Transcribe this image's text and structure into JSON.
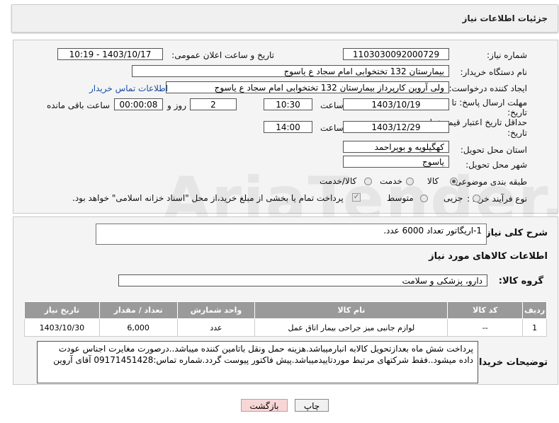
{
  "header": {
    "title": "جزئیات اطلاعات نیاز"
  },
  "watermark": "AriaTender.net",
  "form": {
    "need_number_label": "شماره نیاز:",
    "need_number": "1103030092000729",
    "announce_label": "تاریخ و ساعت اعلان عمومی:",
    "announce_value": "1403/10/17 - 10:19",
    "buyer_org_label": "نام دستگاه خریدار:",
    "buyer_org": "بیمارستان 132 تختخوابی امام سجاد  ع  یاسوج",
    "creator_label": "ایجاد کننده درخواست:",
    "creator": "ولی آروین کارپرداز بیمارستان 132 تختخوابی امام سجاد  ع  یاسوج",
    "contact_link": "اطلاعات تماس خریدار",
    "deadline_label_1": "مهلت ارسال پاسخ: تا",
    "deadline_label_2": "تاریخ:",
    "deadline_date": "1403/10/19",
    "time_label": "ساعت",
    "deadline_time": "10:30",
    "days_value": "2",
    "days_label": "روز و",
    "remaining_value": "00:00:08",
    "remaining_label": "ساعت باقی مانده",
    "validity_label_1": "حداقل تاریخ اعتبار قیمت: تا",
    "validity_label_2": "تاریخ:",
    "validity_date": "1403/12/29",
    "validity_time": "14:00",
    "province_label": "استان محل تحویل:",
    "province": "کهگیلویه و بویراحمد",
    "city_label": "شهر محل تحویل:",
    "city": "یاسوج",
    "category_label": "طبقه بندی موضوعی:",
    "category_options": [
      "کالا",
      "خدمت",
      "کالا/خدمت"
    ],
    "process_label": "نوع فرآیند خرید :",
    "process_options": [
      "جزیی",
      "متوسط"
    ],
    "payment_note": "پرداخت تمام یا بخشی از مبلغ خرید،از محل \"اسناد خزانه اسلامی\" خواهد بود."
  },
  "details": {
    "summary_label": "شرح کلی نیاز:",
    "summary": "1-اریگاتور تعداد 6000 عدد.",
    "goods_info_title": "اطلاعات کالاهای مورد نیاز",
    "goods_group_label": "گروه کالا:",
    "goods_group": "دارو، پزشکی و سلامت",
    "table_headers": [
      "ردیف",
      "کد کالا",
      "نام کالا",
      "واحد شمارش",
      "تعداد / مقدار",
      "تاریخ نیاز"
    ],
    "rows": [
      {
        "row": "1",
        "code": "--",
        "name": "لوازم جانبی میز جراحی بیمار اتاق عمل",
        "unit": "عدد",
        "qty": "6,000",
        "date": "1403/10/30"
      }
    ],
    "buyer_notes_label": "توضیحات خریدار:",
    "buyer_notes": "پرداخت شش ماه بعدازتحویل کالابه انبارمیباشد.هزینه حمل ونقل باتامین کننده میباشد..درصورت مغایرت اجناس عودت داده میشود..فقط شرکتهای مرتبط موردتاییدمیباشد.پیش فاکتور پیوست گردد.شماره تماس:09171451428 آقای آروین"
  },
  "buttons": {
    "print": "چاپ",
    "back": "بازگشت"
  },
  "colors": {
    "table_header": "#9a9a9a",
    "link": "#1a4fa0",
    "back_button": "#f7d6d6"
  }
}
